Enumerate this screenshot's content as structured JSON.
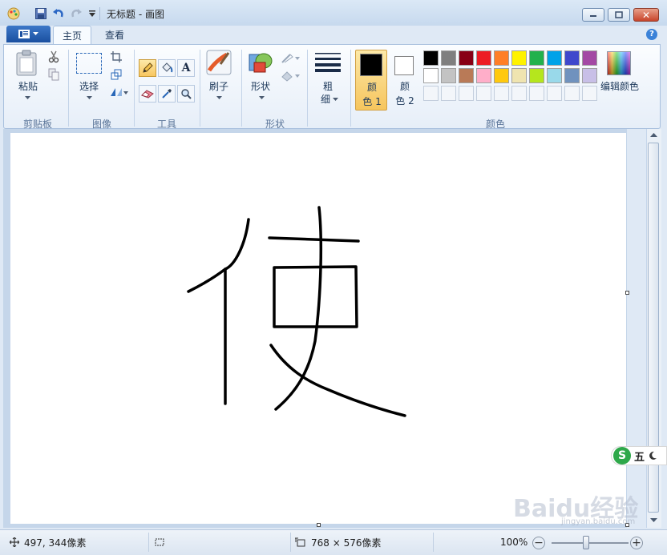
{
  "window": {
    "title": "无标题 - 画图"
  },
  "tabs": [
    {
      "label": "主页",
      "active": true
    },
    {
      "label": "查看",
      "active": false
    }
  ],
  "ribbon": {
    "clipboard": {
      "group": "剪贴板",
      "paste": "粘贴"
    },
    "image": {
      "group": "图像",
      "select": "选择"
    },
    "tools": {
      "group": "工具",
      "text_tool": "A"
    },
    "brushes": {
      "label": "刷子"
    },
    "shapes": {
      "group": "形状",
      "label": "形状"
    },
    "size": {
      "label_top": "粗",
      "label_bottom": "细"
    },
    "colors": {
      "group": "颜色",
      "color1_top": "颜",
      "color1_bottom": "色 1",
      "color2_top": "颜",
      "color2_bottom": "色 2",
      "edit": "编辑颜色",
      "color1": "#000000",
      "color2": "#ffffff",
      "palette_row1": [
        "#000000",
        "#7f7f7f",
        "#880015",
        "#ed1c24",
        "#ff7f27",
        "#fff200",
        "#22b14c",
        "#00a2e8",
        "#3f48cc",
        "#a349a4"
      ],
      "palette_row2": [
        "#ffffff",
        "#c3c3c3",
        "#b97a57",
        "#ffaec9",
        "#ffc90e",
        "#efe4b0",
        "#b5e61d",
        "#99d9ea",
        "#7092be",
        "#c8bfe7"
      ]
    }
  },
  "status": {
    "cursor_pos": "497, 344像素",
    "image_size": "768 × 576像素",
    "zoom": "100%"
  },
  "overlay": {
    "ime_char": "五",
    "watermark": "Baidu经验",
    "watermark_sub": "jingyan.baidu.com"
  }
}
